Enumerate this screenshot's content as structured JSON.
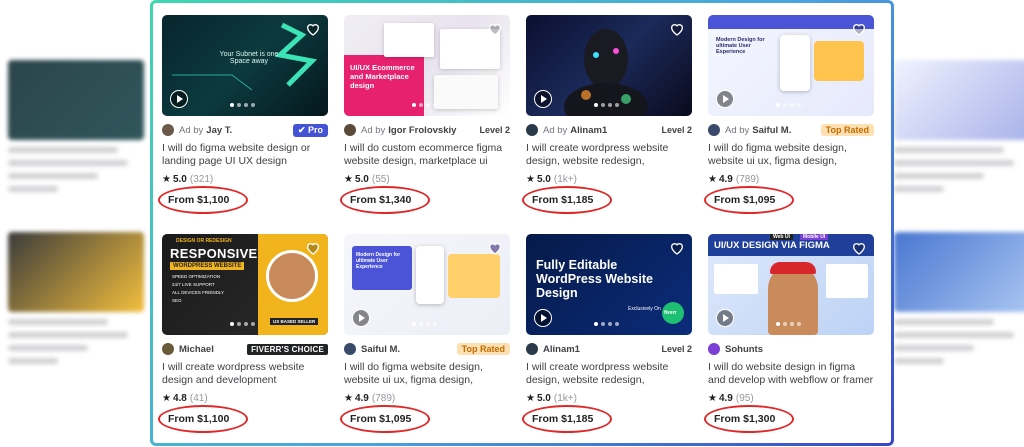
{
  "gigs": [
    {
      "ad_by": "Ad by",
      "seller": "Jay T.",
      "badge": "Pro",
      "badge_type": "pro",
      "title": "I will do figma website design or landing page UI UX design",
      "rating": "5.0",
      "reviews": "(321)",
      "price": "From $1,100",
      "thumb_text": "Your Subnet is one Space away",
      "avatar_color": "#6b5a4a"
    },
    {
      "ad_by": "Ad by",
      "seller": "Igor Frolovskiy",
      "badge": "Level 2",
      "badge_type": "level",
      "title": "I will do custom ecommerce figma website design, marketplace ui ux...",
      "rating": "5.0",
      "reviews": "(55)",
      "price": "From $1,340",
      "thumb_text": "UI/UX Ecommerce and Marketplace design",
      "avatar_color": "#5a4a3a"
    },
    {
      "ad_by": "Ad by",
      "seller": "Alinam1",
      "badge": "Level 2",
      "badge_type": "level",
      "title": "I will create wordpress website design, website redesign, elemento...",
      "rating": "5.0",
      "reviews": "(1k+)",
      "price": "From $1,185",
      "thumb_text": "",
      "avatar_color": "#2a3a4a"
    },
    {
      "ad_by": "Ad by",
      "seller": "Saiful M.",
      "badge": "Top Rated",
      "badge_type": "top",
      "title": "I will do figma website design, website ui ux, figma design, figma...",
      "rating": "4.9",
      "reviews": "(789)",
      "price": "From $1,095",
      "thumb_text": "Modern Design for ultimate User Experience",
      "avatar_color": "#3a4a6a"
    },
    {
      "ad_by": "",
      "seller": "Michael",
      "badge": "FIVERR'S CHOICE",
      "badge_type": "choice",
      "title": "I will create wordpress website design and development",
      "rating": "4.8",
      "reviews": "(41)",
      "price": "From $1,100",
      "thumb_text": "RESPONSIVE",
      "thumb_text_2": "WORDPRESS WEBSITE",
      "thumb_text_3": "DESIGN OR REDESIGN",
      "thumb_bullets": [
        "SPEED OPTIMIZATION",
        "24/7 LIVE SUPPORT",
        "ALL DEVICES FRIENDLY",
        "SEO"
      ],
      "thumb_text_4": "US BASED SELLER",
      "avatar_color": "#6a5a3a"
    },
    {
      "ad_by": "",
      "seller": "Saiful M.",
      "badge": "Top Rated",
      "badge_type": "top",
      "title": "I will do figma website design, website ui ux, figma design, figma...",
      "rating": "4.9",
      "reviews": "(789)",
      "price": "From $1,095",
      "thumb_text": "Modern Design for ultimate User Experience",
      "avatar_color": "#3a4a6a"
    },
    {
      "ad_by": "",
      "seller": "Alinam1",
      "badge": "Level 2",
      "badge_type": "level",
      "title": "I will create wordpress website design, website redesign, elemento...",
      "rating": "5.0",
      "reviews": "(1k+)",
      "price": "From $1,185",
      "thumb_text": "Fully Editable WordPress Website Design",
      "thumb_text_2": "Exclusively On",
      "thumb_text_3": "fiverr",
      "avatar_color": "#2a3a4a"
    },
    {
      "ad_by": "",
      "seller": "Sohunts",
      "badge": "",
      "badge_type": "none",
      "title": "I will do website design in figma and develop with webflow or framer",
      "rating": "4.9",
      "reviews": "(95)",
      "price": "From $1,300",
      "thumb_text": "UI/UX DESIGN VIA FIGMA",
      "thumb_text_2": "Web UI",
      "thumb_text_3": "Mobile UI",
      "avatar_color": "#7b3fd6"
    }
  ],
  "colors": {
    "frame_start": "#3fd6b0",
    "frame_end": "#3a46c9",
    "annotation_ring": "#e02828",
    "pro_badge": "#4452d6",
    "top_rated_bg": "#ffe0b2"
  },
  "icons": {
    "heart": "heart-icon",
    "play": "play-icon",
    "star": "star-icon"
  },
  "star_glyph": "★"
}
